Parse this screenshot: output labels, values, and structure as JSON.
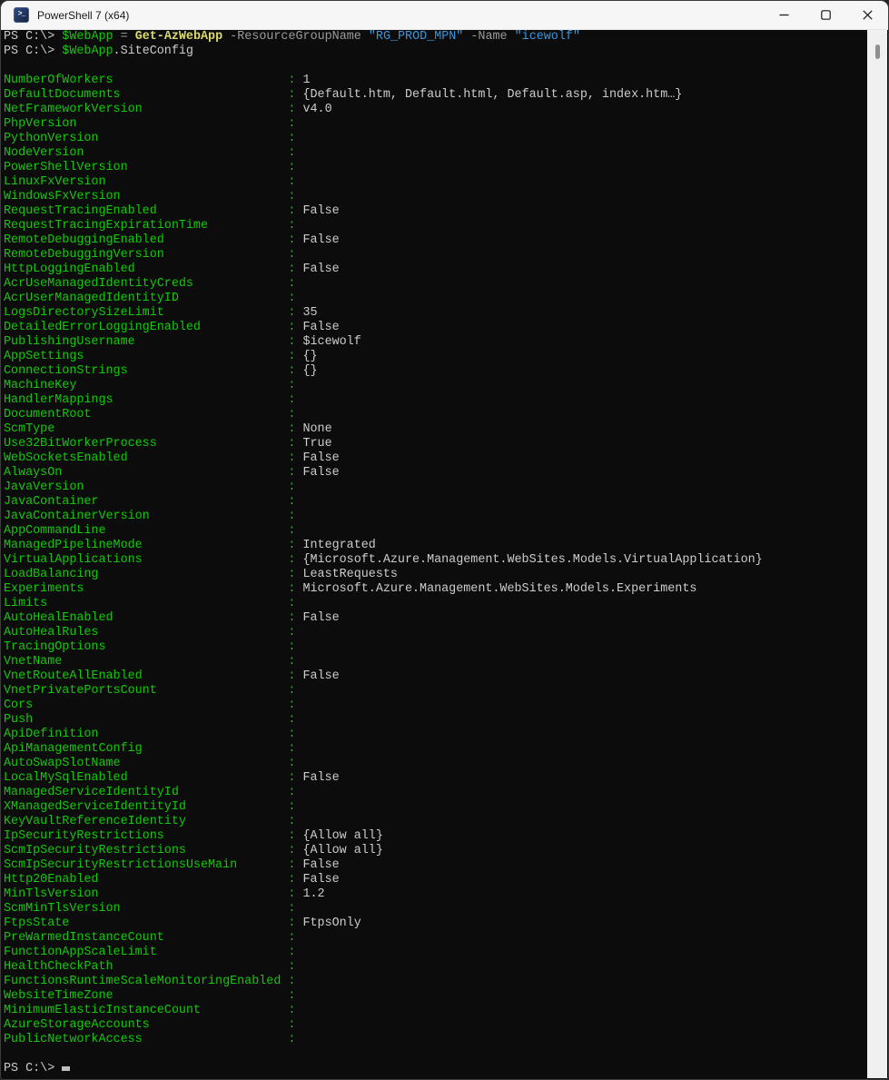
{
  "window": {
    "title": "PowerShell 7 (x64)",
    "icon_glyph": ">_",
    "titlebar_bg": "#f6f6f6",
    "controls": [
      "minimize",
      "maximize",
      "close"
    ]
  },
  "terminal": {
    "background": "#0C0C0C",
    "colors": {
      "default": "#CCCCCC",
      "green": "#16C60C",
      "command": "#DCDC6E",
      "parameter": "#9A9A9A",
      "string": "#3A96DD"
    },
    "prompt": "PS C:\\> ",
    "commands": [
      {
        "tokens": [
          {
            "text": "PS C:\\> ",
            "type": "default"
          },
          {
            "text": "$WebApp",
            "type": "variable"
          },
          {
            "text": " ",
            "type": "default"
          },
          {
            "text": "=",
            "type": "operator"
          },
          {
            "text": " ",
            "type": "default"
          },
          {
            "text": "Get-AzWebApp",
            "type": "command"
          },
          {
            "text": " ",
            "type": "default"
          },
          {
            "text": "-ResourceGroupName",
            "type": "parameter"
          },
          {
            "text": " ",
            "type": "default"
          },
          {
            "text": "\"RG_PROD_MPN\"",
            "type": "string"
          },
          {
            "text": " ",
            "type": "default"
          },
          {
            "text": "-Name",
            "type": "parameter"
          },
          {
            "text": " ",
            "type": "default"
          },
          {
            "text": "\"icewolf\"",
            "type": "string"
          }
        ]
      },
      {
        "tokens": [
          {
            "text": "PS C:\\> ",
            "type": "default"
          },
          {
            "text": "$WebApp",
            "type": "variable"
          },
          {
            "text": ".SiteConfig",
            "type": "default"
          }
        ]
      }
    ],
    "name_column_width": 38,
    "output": [
      {
        "name": "NumberOfWorkers",
        "value": "1"
      },
      {
        "name": "DefaultDocuments",
        "value": "{Default.htm, Default.html, Default.asp, index.htm…}"
      },
      {
        "name": "NetFrameworkVersion",
        "value": "v4.0"
      },
      {
        "name": "PhpVersion",
        "value": ""
      },
      {
        "name": "PythonVersion",
        "value": ""
      },
      {
        "name": "NodeVersion",
        "value": ""
      },
      {
        "name": "PowerShellVersion",
        "value": ""
      },
      {
        "name": "LinuxFxVersion",
        "value": ""
      },
      {
        "name": "WindowsFxVersion",
        "value": ""
      },
      {
        "name": "RequestTracingEnabled",
        "value": "False"
      },
      {
        "name": "RequestTracingExpirationTime",
        "value": ""
      },
      {
        "name": "RemoteDebuggingEnabled",
        "value": "False"
      },
      {
        "name": "RemoteDebuggingVersion",
        "value": ""
      },
      {
        "name": "HttpLoggingEnabled",
        "value": "False"
      },
      {
        "name": "AcrUseManagedIdentityCreds",
        "value": ""
      },
      {
        "name": "AcrUserManagedIdentityID",
        "value": ""
      },
      {
        "name": "LogsDirectorySizeLimit",
        "value": "35"
      },
      {
        "name": "DetailedErrorLoggingEnabled",
        "value": "False"
      },
      {
        "name": "PublishingUsername",
        "value": "$icewolf"
      },
      {
        "name": "AppSettings",
        "value": "{}"
      },
      {
        "name": "ConnectionStrings",
        "value": "{}"
      },
      {
        "name": "MachineKey",
        "value": ""
      },
      {
        "name": "HandlerMappings",
        "value": ""
      },
      {
        "name": "DocumentRoot",
        "value": ""
      },
      {
        "name": "ScmType",
        "value": "None"
      },
      {
        "name": "Use32BitWorkerProcess",
        "value": "True"
      },
      {
        "name": "WebSocketsEnabled",
        "value": "False"
      },
      {
        "name": "AlwaysOn",
        "value": "False"
      },
      {
        "name": "JavaVersion",
        "value": ""
      },
      {
        "name": "JavaContainer",
        "value": ""
      },
      {
        "name": "JavaContainerVersion",
        "value": ""
      },
      {
        "name": "AppCommandLine",
        "value": ""
      },
      {
        "name": "ManagedPipelineMode",
        "value": "Integrated"
      },
      {
        "name": "VirtualApplications",
        "value": "{Microsoft.Azure.Management.WebSites.Models.VirtualApplication}"
      },
      {
        "name": "LoadBalancing",
        "value": "LeastRequests"
      },
      {
        "name": "Experiments",
        "value": "Microsoft.Azure.Management.WebSites.Models.Experiments"
      },
      {
        "name": "Limits",
        "value": ""
      },
      {
        "name": "AutoHealEnabled",
        "value": "False"
      },
      {
        "name": "AutoHealRules",
        "value": ""
      },
      {
        "name": "TracingOptions",
        "value": ""
      },
      {
        "name": "VnetName",
        "value": ""
      },
      {
        "name": "VnetRouteAllEnabled",
        "value": "False"
      },
      {
        "name": "VnetPrivatePortsCount",
        "value": ""
      },
      {
        "name": "Cors",
        "value": ""
      },
      {
        "name": "Push",
        "value": ""
      },
      {
        "name": "ApiDefinition",
        "value": ""
      },
      {
        "name": "ApiManagementConfig",
        "value": ""
      },
      {
        "name": "AutoSwapSlotName",
        "value": ""
      },
      {
        "name": "LocalMySqlEnabled",
        "value": "False"
      },
      {
        "name": "ManagedServiceIdentityId",
        "value": ""
      },
      {
        "name": "XManagedServiceIdentityId",
        "value": ""
      },
      {
        "name": "KeyVaultReferenceIdentity",
        "value": ""
      },
      {
        "name": "IpSecurityRestrictions",
        "value": "{Allow all}"
      },
      {
        "name": "ScmIpSecurityRestrictions",
        "value": "{Allow all}"
      },
      {
        "name": "ScmIpSecurityRestrictionsUseMain",
        "value": "False"
      },
      {
        "name": "Http20Enabled",
        "value": "False"
      },
      {
        "name": "MinTlsVersion",
        "value": "1.2"
      },
      {
        "name": "ScmMinTlsVersion",
        "value": ""
      },
      {
        "name": "FtpsState",
        "value": "FtpsOnly"
      },
      {
        "name": "PreWarmedInstanceCount",
        "value": ""
      },
      {
        "name": "FunctionAppScaleLimit",
        "value": ""
      },
      {
        "name": "HealthCheckPath",
        "value": ""
      },
      {
        "name": "FunctionsRuntimeScaleMonitoringEnabled",
        "value": ""
      },
      {
        "name": "WebsiteTimeZone",
        "value": ""
      },
      {
        "name": "MinimumElasticInstanceCount",
        "value": ""
      },
      {
        "name": "AzureStorageAccounts",
        "value": ""
      },
      {
        "name": "PublicNetworkAccess",
        "value": ""
      }
    ],
    "final_prompt": "PS C:\\> "
  }
}
